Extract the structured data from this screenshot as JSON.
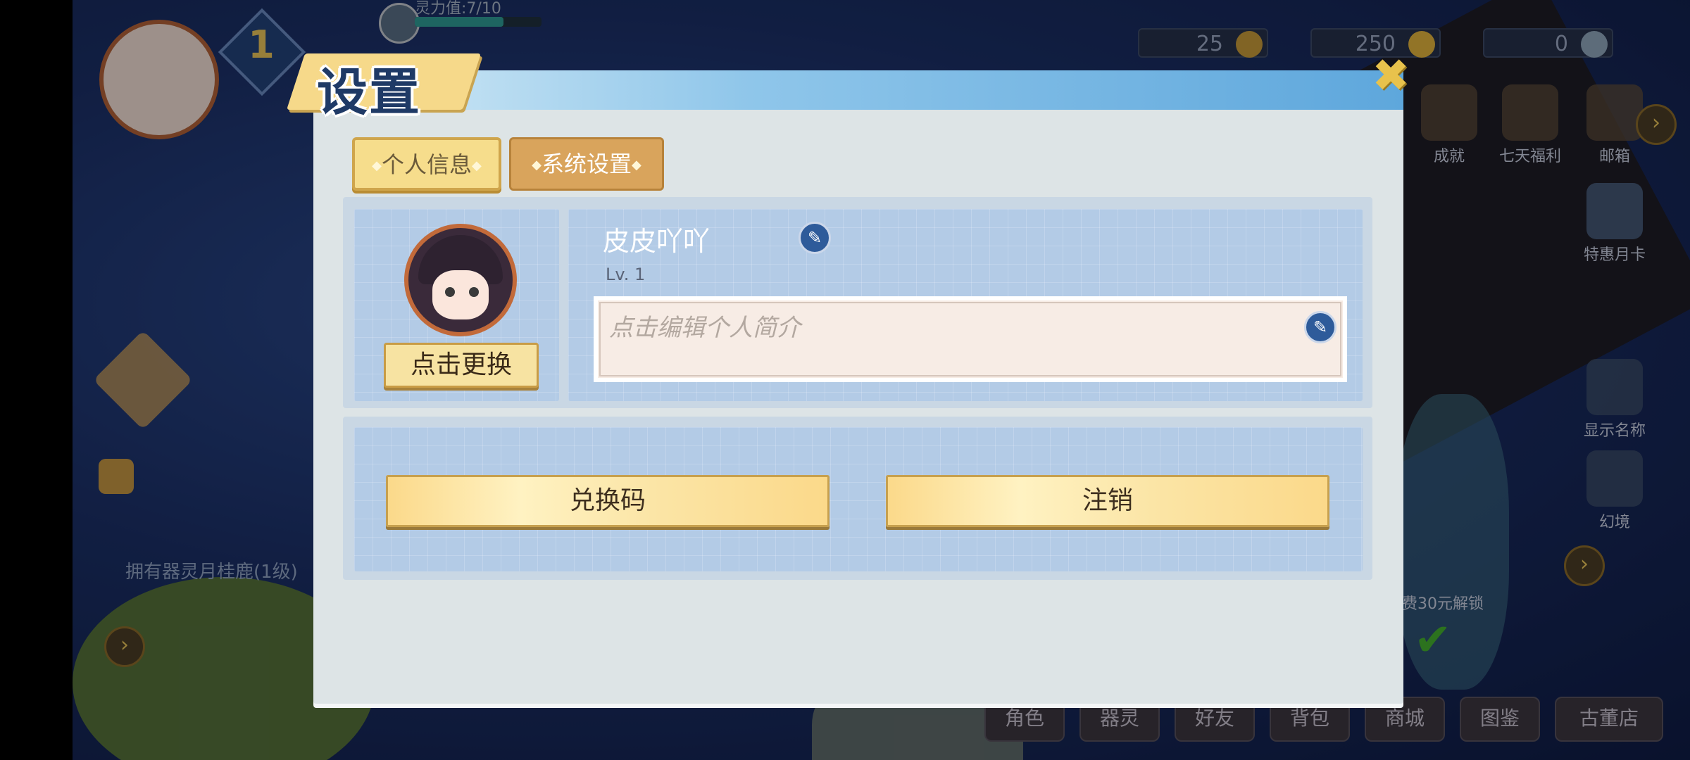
{
  "hud": {
    "player_level": "1",
    "spirit_label": "灵力值:7/10",
    "currency_1": "25",
    "currency_2": "250",
    "currency_3": "0"
  },
  "side_menu": {
    "item_1": "成就",
    "item_2": "七天福利",
    "item_3": "邮箱",
    "item_4": "特惠月卡",
    "item_5": "显示名称",
    "item_6": "幻境"
  },
  "quest_text": "拥有器灵月桂鹿(1级)",
  "unlock_text": "费30元解锁",
  "bottom_nav": [
    "角色",
    "器灵",
    "好友",
    "背包",
    "商城",
    "图鉴",
    "古董店"
  ],
  "dialog": {
    "title": "设置",
    "close_icon": "close-icon",
    "tabs": {
      "personal": "个人信息",
      "system": "系统设置"
    },
    "profile": {
      "change_avatar": "点击更换",
      "nickname": "皮皮吖吖",
      "level": "Lv. 1",
      "intro_placeholder": "点击编辑个人简介"
    },
    "buttons": {
      "redeem": "兑换码",
      "logout": "注销"
    }
  },
  "colors": {
    "dialog_bg": "#dde4e6",
    "panel_bg": "#b3cbe6",
    "button_gold": "#fbd98a",
    "tab_active": "#f6dd8c",
    "tab_inactive": "#d9a45c"
  }
}
